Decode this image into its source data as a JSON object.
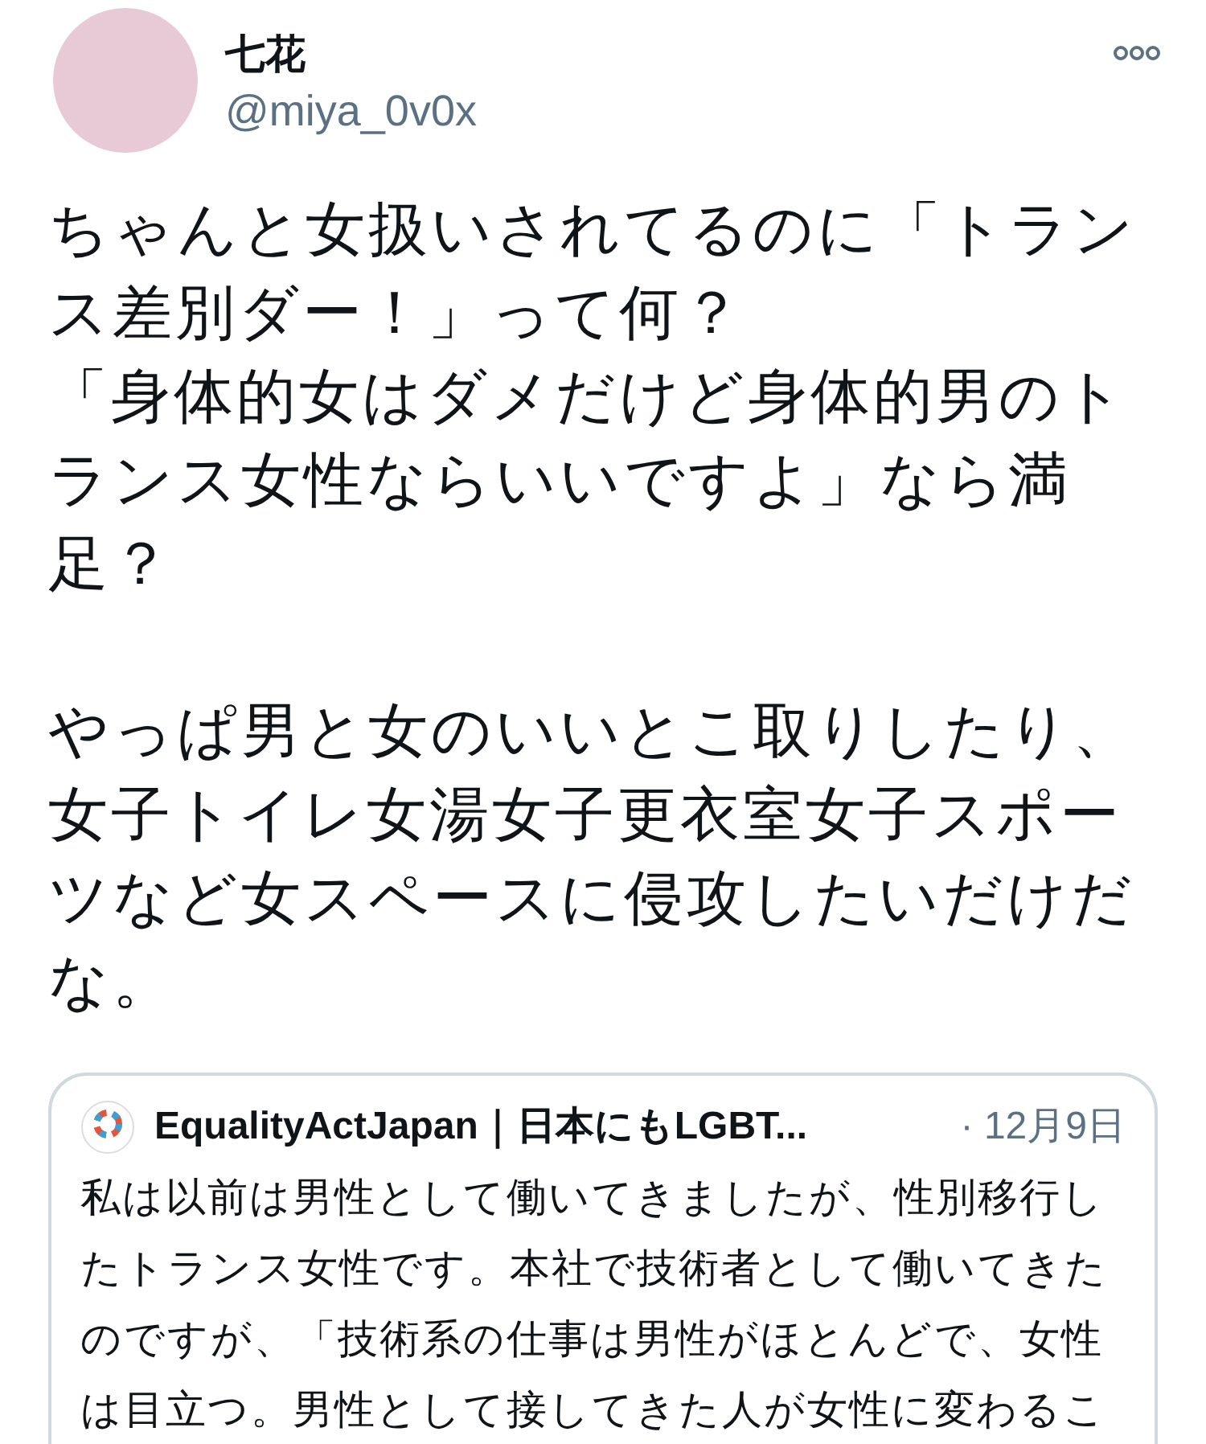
{
  "author": {
    "name": "七花",
    "handle": "@miya_0v0x"
  },
  "tweet": {
    "paragraphs": [
      [
        "ちゃんと女扱いされてるのに「トランス差別ダー！」って何？",
        "「身体的女はダメだけど身体的男のトランス女性ならいいですよ」なら満足？"
      ],
      [
        "やっぱ男と女のいいとこ取りしたり、女子トイレ女湯女子更衣室女子スポーツなど女スペースに侵攻したいだけだな。"
      ]
    ]
  },
  "quoted_tweet": {
    "author": "EqualityActJapan｜日本にもLGBT...",
    "date": "· 12月9日",
    "text": "私は以前は男性として働いてきましたが、性別移行したトランス女性です。本社で技術者として働いてきたのですが、「技術系の仕事は男性がほとんどで、女性は目立つ。男性として接してきた人が女性に変わるこ"
  }
}
